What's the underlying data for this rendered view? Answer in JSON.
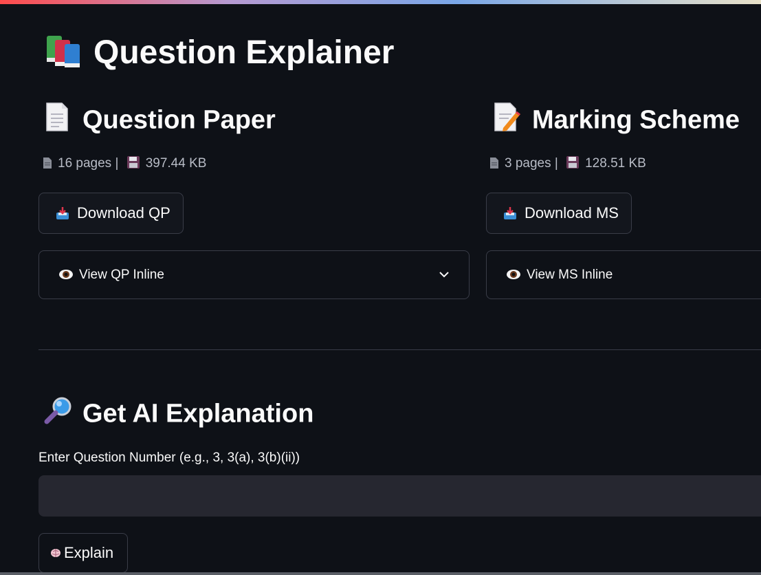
{
  "app": {
    "title": "Question Explainer",
    "title_icon": "books-icon"
  },
  "question_paper": {
    "heading": "Question Paper",
    "heading_icon": "page-icon",
    "pages_text": "16 pages |",
    "size_text": "397.44 KB",
    "download_label": "Download QP",
    "view_label": "View QP Inline"
  },
  "marking_scheme": {
    "heading": "Marking Scheme",
    "heading_icon": "memo-icon",
    "pages_text": "3 pages |",
    "size_text": "128.51 KB",
    "download_label": "Download MS",
    "view_label": "View MS Inline"
  },
  "explanation": {
    "heading": "Get AI Explanation",
    "heading_icon": "magnifier-icon",
    "input_label": "Enter Question Number (e.g., 3, 3(a), 3(b)(ii))",
    "input_value": "",
    "explain_label": "Explain"
  },
  "colors": {
    "background": "#0e1117",
    "text": "#fafafa",
    "muted": "#b8bcc6",
    "border": "#3a3d48",
    "input_bg": "#262730"
  }
}
